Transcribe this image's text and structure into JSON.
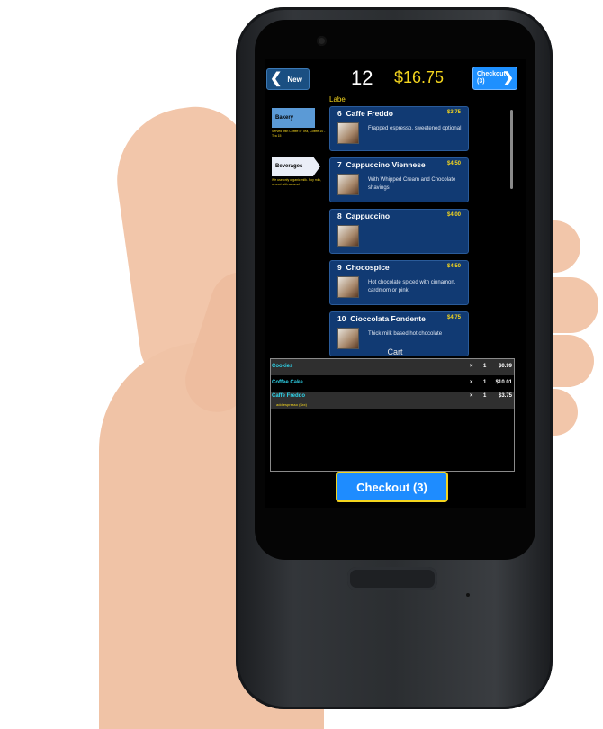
{
  "header": {
    "new_label": "New",
    "order_number": "12",
    "total": "$16.75",
    "checkout_label": "Checkout",
    "checkout_count": "(3)"
  },
  "section_label": "Label",
  "categories": [
    {
      "name": "Bakery",
      "description": "Served with Coffee or Tea, Coffee 10 - Tea 15"
    },
    {
      "name": "Beverages",
      "description": "We use only organic milk. Soy milk, served with caramel"
    }
  ],
  "items": [
    {
      "num": "6",
      "name": "Caffe Freddo",
      "price": "$3.75",
      "description": "Frapped espresso, sweetened optional"
    },
    {
      "num": "7",
      "name": "Cappuccino Viennese",
      "price": "$4.50",
      "description": "With Whipped Cream and Chocolate shavings"
    },
    {
      "num": "8",
      "name": "Cappuccino",
      "price": "$4.00",
      "description": ""
    },
    {
      "num": "9",
      "name": "Chocospice",
      "price": "$4.50",
      "description": "Hot chocolate spiced with cinnamon, cardmom or pink"
    },
    {
      "num": "10",
      "name": "Cioccolata Fondente",
      "price": "$4.75",
      "description": "Thick milk based hot chocolate"
    }
  ],
  "cart": {
    "title": "Cart",
    "rows": [
      {
        "name": "Cookies",
        "x": "×",
        "qty": "1",
        "price": "$0.99"
      },
      {
        "name": "Coffee Cake",
        "x": "×",
        "qty": "1",
        "price": "$10.01"
      },
      {
        "name": "Caffe Freddo",
        "x": "×",
        "qty": "1",
        "price": "$3.75",
        "modifier": "add espresso ($xx)"
      }
    ]
  },
  "checkout_button": "Checkout (3)",
  "colors": {
    "accent": "#1e8cff",
    "price": "#f4d51e",
    "cart_name": "#2fd4ea",
    "tile": "#113a73"
  }
}
